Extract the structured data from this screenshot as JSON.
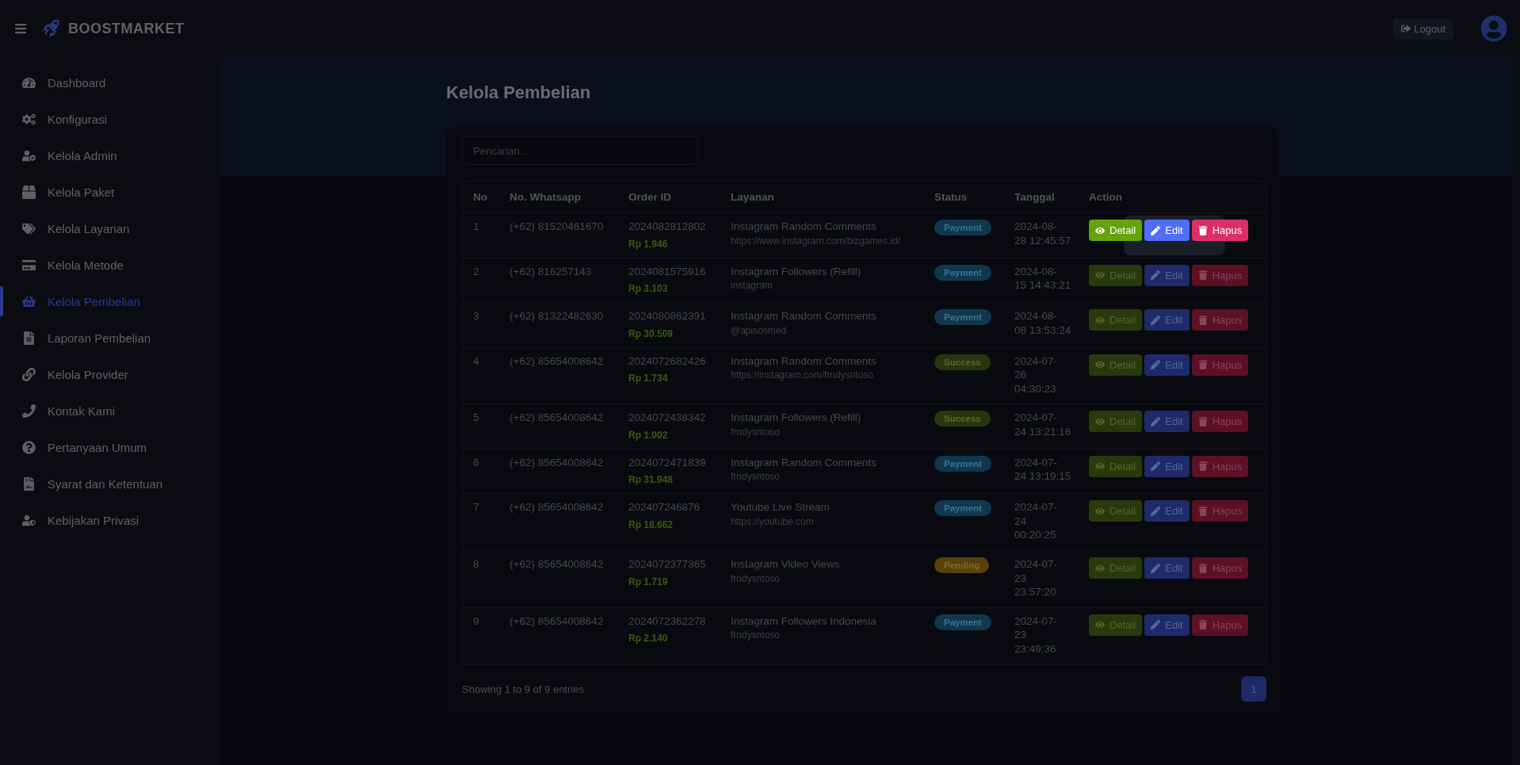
{
  "brand": "BOOSTMARKET",
  "topbar": {
    "logout": "Logout"
  },
  "sidebar": {
    "items": [
      {
        "label": "Dashboard",
        "selected": false
      },
      {
        "label": "Konfigurasi",
        "selected": false
      },
      {
        "label": "Kelola Admin",
        "selected": false
      },
      {
        "label": "Kelola Paket",
        "selected": false
      },
      {
        "label": "Kelola Layanan",
        "selected": false
      },
      {
        "label": "Kelola Metode",
        "selected": false
      },
      {
        "label": "Kelola Pembelian",
        "selected": true
      },
      {
        "label": "Laporan Pembelian",
        "selected": false
      },
      {
        "label": "Kelola Provider",
        "selected": false
      },
      {
        "label": "Kontak Kami",
        "selected": false
      },
      {
        "label": "Pertanyaan Umum",
        "selected": false
      },
      {
        "label": "Syarat dan Ketentuan",
        "selected": false
      },
      {
        "label": "Kebijakan Privasi",
        "selected": false
      }
    ]
  },
  "page_title": "Kelola Pembelian",
  "search": {
    "placeholder": "Pencarian..."
  },
  "table": {
    "columns": [
      "No",
      "No. Whatsapp",
      "Order ID",
      "Layanan",
      "Status",
      "Tanggal",
      "Action"
    ],
    "rows": [
      {
        "no": "1",
        "whatsapp": "(+62) 81520461670",
        "order_id": "2024082812802",
        "price": "Rp 1.946",
        "service": "Instagram Random Comments",
        "target": "https://www.instagram.com/bizgames.id/",
        "status": {
          "label": "Payment",
          "kind": "payment"
        },
        "date": "2024-08-\n28 12:45:57",
        "highlighted": true,
        "actions": [
          "Detail",
          "Edit",
          "Hapus"
        ]
      },
      {
        "no": "2",
        "whatsapp": "(+62) 816257143",
        "order_id": "2024081575916",
        "price": "Rp 3.103",
        "service": "Instagram Followers (Refill)",
        "target": "instagram",
        "status": {
          "label": "Payment",
          "kind": "payment"
        },
        "date": "2024-08-\n15 14:43:21",
        "highlighted": false,
        "actions": [
          "Detail",
          "Edit",
          "Hapus"
        ]
      },
      {
        "no": "3",
        "whatsapp": "(+62) 81322482630",
        "order_id": "2024080862391",
        "price": "Rp 30.509",
        "service": "Instagram Random Comments",
        "target": "@apisosmed",
        "status": {
          "label": "Payment",
          "kind": "payment"
        },
        "date": "2024-08-\n08 13:53:24",
        "highlighted": false,
        "actions": [
          "Detail",
          "Edit",
          "Hapus"
        ]
      },
      {
        "no": "4",
        "whatsapp": "(+62) 85654008642",
        "order_id": "2024072682426",
        "price": "Rp 1.734",
        "service": "Instagram Random Comments",
        "target": "https://instagram.com/frndysntoso",
        "status": {
          "label": "Success",
          "kind": "success"
        },
        "date": "2024-07-\n26\n04:30:23",
        "highlighted": false,
        "actions": [
          "Detail",
          "Edit",
          "Hapus"
        ]
      },
      {
        "no": "5",
        "whatsapp": "(+62) 85654008642",
        "order_id": "2024072438342",
        "price": "Rp 1.002",
        "service": "Instagram Followers (Refill)",
        "target": "frndysntoso",
        "status": {
          "label": "Success",
          "kind": "success"
        },
        "date": "2024-07-\n24 13:21:16",
        "highlighted": false,
        "actions": [
          "Detail",
          "Edit",
          "Hapus"
        ]
      },
      {
        "no": "6",
        "whatsapp": "(+62) 85654008642",
        "order_id": "2024072471839",
        "price": "Rp 31.948",
        "service": "Instagram Random Comments",
        "target": "frndysntoso",
        "status": {
          "label": "Payment",
          "kind": "payment"
        },
        "date": "2024-07-\n24 13:19:15",
        "highlighted": false,
        "actions": [
          "Detail",
          "Edit",
          "Hapus"
        ]
      },
      {
        "no": "7",
        "whatsapp": "(+62) 85654008642",
        "order_id": "202407246876",
        "price": "Rp 18.662",
        "service": "Youtube Live Stream",
        "target": "https://youtube.com",
        "status": {
          "label": "Payment",
          "kind": "payment"
        },
        "date": "2024-07-\n24\n00:20:25",
        "highlighted": false,
        "actions": [
          "Detail",
          "Edit",
          "Hapus"
        ]
      },
      {
        "no": "8",
        "whatsapp": "(+62) 85654008642",
        "order_id": "2024072377365",
        "price": "Rp 1.719",
        "service": "Instagram Video Views",
        "target": "frndysntoso",
        "status": {
          "label": "Pending",
          "kind": "pending"
        },
        "date": "2024-07-\n23\n23:57:20",
        "highlighted": false,
        "actions": [
          "Detail",
          "Edit",
          "Hapus"
        ]
      },
      {
        "no": "9",
        "whatsapp": "(+62) 85654008642",
        "order_id": "2024072362278",
        "price": "Rp 2.140",
        "service": "Instagram Followers Indonesia",
        "target": "frndysntoso",
        "status": {
          "label": "Payment",
          "kind": "payment"
        },
        "date": "2024-07-\n23\n23:49:36",
        "highlighted": false,
        "actions": [
          "Detail",
          "Edit",
          "Hapus"
        ]
      }
    ]
  },
  "footer": {
    "info": "Showing 1 to 9 of 9 entries",
    "pages": [
      {
        "label": "1",
        "selected": true
      }
    ]
  }
}
